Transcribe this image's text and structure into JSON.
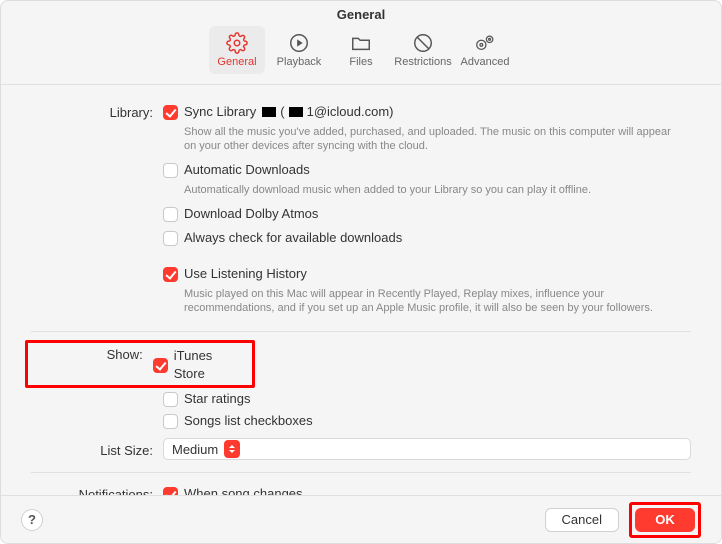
{
  "title": "General",
  "toolbar": {
    "items": [
      {
        "label": "General"
      },
      {
        "label": "Playback"
      },
      {
        "label": "Files"
      },
      {
        "label": "Restrictions"
      },
      {
        "label": "Advanced"
      }
    ]
  },
  "library": {
    "label": "Library:",
    "sync": {
      "label": "Sync Library",
      "email_suffix": "1@icloud.com)",
      "checked": true
    },
    "sync_sub": "Show all the music you've added, purchased, and uploaded. The music on this computer will appear on your other devices after syncing with the cloud.",
    "auto": {
      "label": "Automatic Downloads",
      "checked": false
    },
    "auto_sub": "Automatically download music when added to your Library so you can play it offline.",
    "dolby": {
      "label": "Download Dolby Atmos",
      "checked": false
    },
    "check_dl": {
      "label": "Always check for available downloads",
      "checked": false
    },
    "history": {
      "label": "Use Listening History",
      "checked": true
    },
    "history_sub": "Music played on this Mac will appear in Recently Played, Replay mixes, influence your recommendations, and if you set up an Apple Music profile, it will also be seen by your followers."
  },
  "show": {
    "label": "Show:",
    "itunes": {
      "label": "iTunes Store",
      "checked": true
    },
    "star": {
      "label": "Star ratings",
      "checked": false
    },
    "songcb": {
      "label": "Songs list checkboxes",
      "checked": false
    }
  },
  "list_size": {
    "label": "List Size:",
    "value": "Medium"
  },
  "notifications": {
    "label": "Notifications:",
    "song_change": {
      "label": "When song changes",
      "checked": true
    }
  },
  "footer": {
    "help": "?",
    "cancel": "Cancel",
    "ok": "OK"
  }
}
